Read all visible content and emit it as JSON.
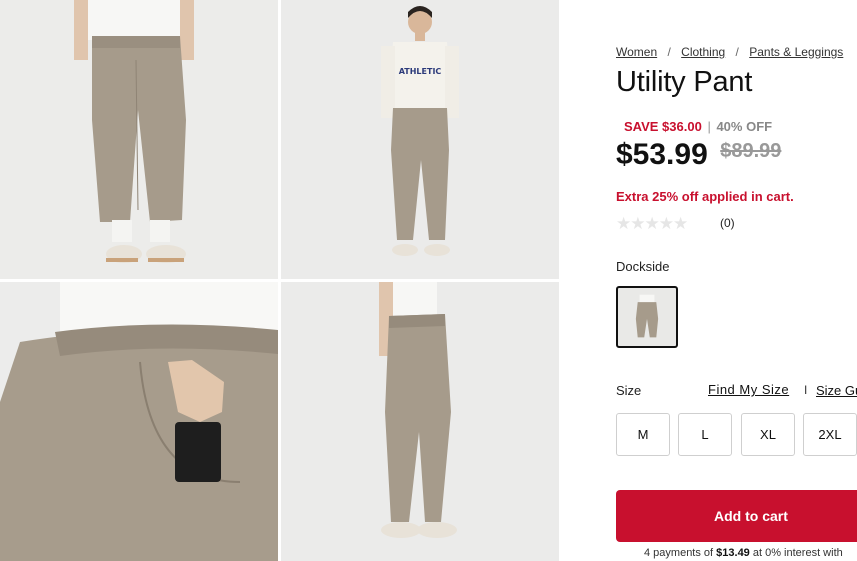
{
  "breadcrumb": [
    {
      "label": "Women"
    },
    {
      "label": "Clothing"
    },
    {
      "label": "Pants & Leggings"
    }
  ],
  "breadcrumb_sep": "/",
  "product": {
    "title": "Utility Pant",
    "save_text": "SAVE $36.00",
    "save_sep": "|",
    "discount_text": "40% OFF",
    "price": "$53.99",
    "original_price": "$89.99",
    "promo": "Extra 25% off applied in cart.",
    "rating_stars": "★★★★★",
    "rating_count": "(0)",
    "color_name": "Dockside"
  },
  "size": {
    "label": "Size",
    "find_my_size": "Find My Size",
    "separator": "I",
    "guide": "Size Guide",
    "options": [
      "M",
      "L",
      "XL",
      "2XL"
    ]
  },
  "cart": {
    "add_label": "Add to cart",
    "payments_prefix": "4 payments of ",
    "payments_amount": "$13.49",
    "payments_suffix": " at 0% interest with"
  },
  "colors": {
    "accent": "#c8102e",
    "pant": "#a69b8b",
    "background": "#ececea"
  },
  "gallery": [
    {
      "icon": "product-photo-front-closeup"
    },
    {
      "icon": "product-photo-full-model"
    },
    {
      "icon": "product-photo-pocket-detail"
    },
    {
      "icon": "product-photo-side-view"
    }
  ]
}
